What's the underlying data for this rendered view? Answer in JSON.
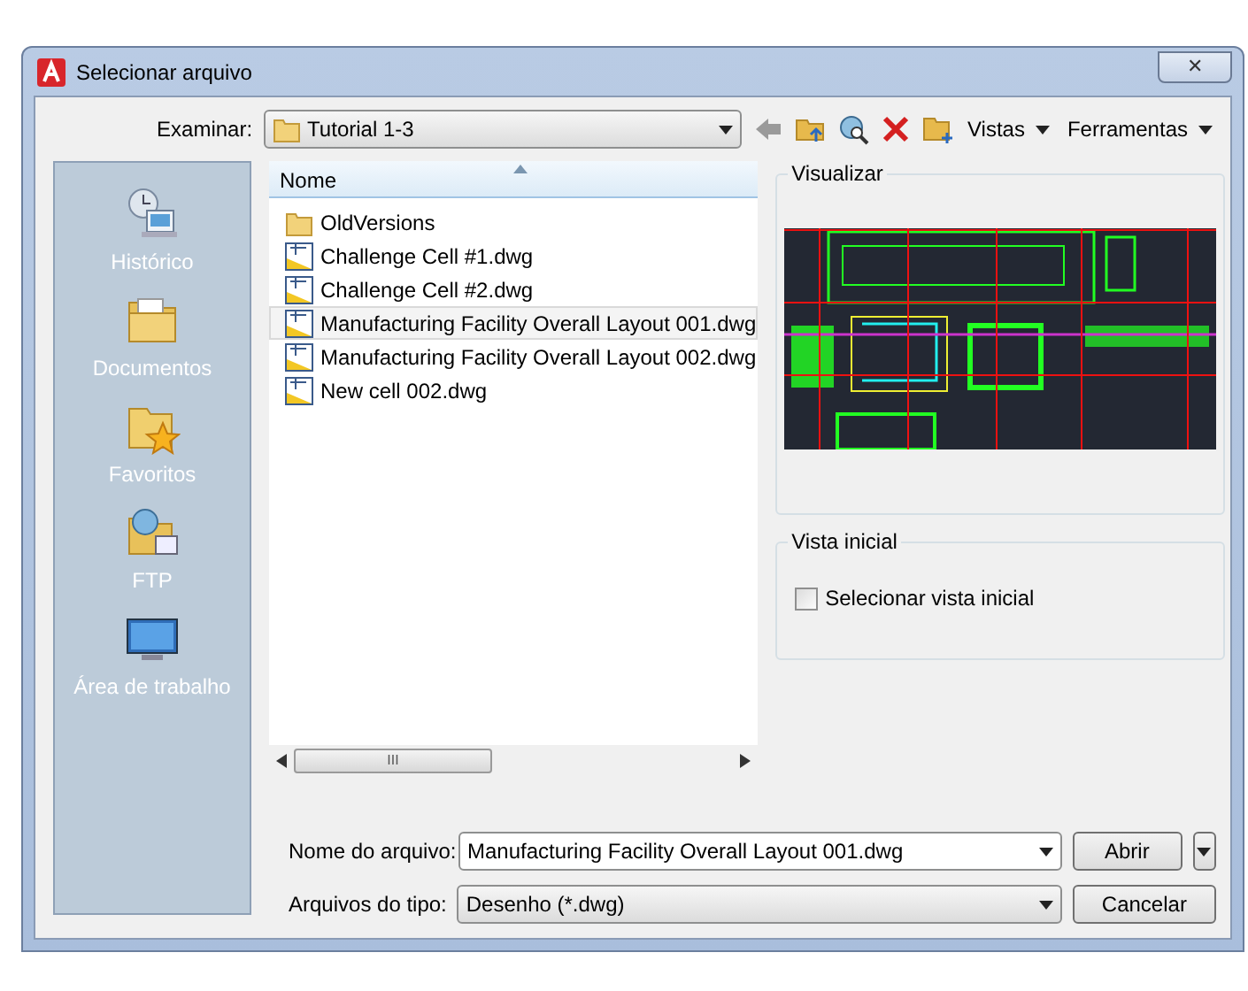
{
  "window": {
    "title": "Selecionar arquivo",
    "close": "✕"
  },
  "toolbar": {
    "look_in_label": "Examinar:",
    "look_in_value": "Tutorial 1-3",
    "menus": [
      "Vistas",
      "Ferramentas"
    ]
  },
  "sidebar": {
    "items": [
      {
        "label": "Histórico",
        "kind": "history",
        "selected": false
      },
      {
        "label": "Documentos",
        "kind": "documents",
        "selected": false
      },
      {
        "label": "Favoritos",
        "kind": "favorites",
        "selected": false
      },
      {
        "label": "FTP",
        "kind": "ftp",
        "selected": false
      },
      {
        "label": "Área de trabalho",
        "kind": "desktop",
        "selected": false
      }
    ]
  },
  "file_list": {
    "column": "Nome",
    "scroll_thumb": "III",
    "items": [
      {
        "name": "OldVersions",
        "kind": "folder",
        "selected": false
      },
      {
        "name": "Challenge Cell #1.dwg",
        "kind": "dwg",
        "selected": false
      },
      {
        "name": "Challenge Cell #2.dwg",
        "kind": "dwg",
        "selected": false
      },
      {
        "name": "Manufacturing Facility Overall Layout 001.dwg",
        "kind": "dwg",
        "selected": true
      },
      {
        "name": "Manufacturing Facility Overall Layout 002.dwg",
        "kind": "dwg",
        "selected": false
      },
      {
        "name": "New cell 002.dwg",
        "kind": "dwg",
        "selected": false
      }
    ]
  },
  "preview": {
    "title": "Visualizar"
  },
  "initial_view": {
    "title": "Vista inicial",
    "checkbox_label": "Selecionar vista inicial",
    "checked": false
  },
  "file_name": {
    "label": "Nome do arquivo:",
    "value": "Manufacturing Facility Overall Layout 001.dwg"
  },
  "file_type": {
    "label": "Arquivos do tipo:",
    "value": "Desenho (*.dwg)"
  },
  "buttons": {
    "open": "Abrir",
    "cancel": "Cancelar"
  }
}
